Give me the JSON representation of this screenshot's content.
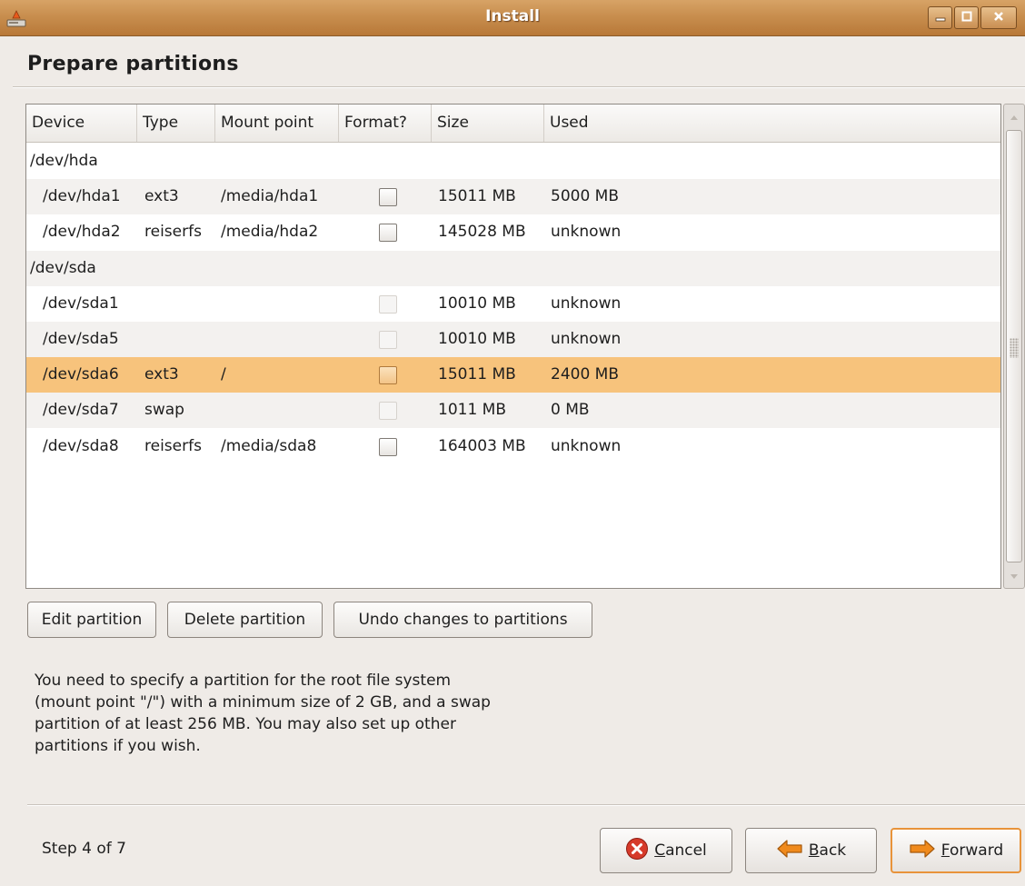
{
  "window": {
    "title": "Install"
  },
  "page": {
    "title": "Prepare partitions"
  },
  "table": {
    "columns": [
      "Device",
      "Type",
      "Mount point",
      "Format?",
      "Size",
      "Used"
    ],
    "rows": [
      {
        "device": "/dev/hda",
        "type": "",
        "mount": "",
        "format": "none",
        "size": "",
        "used": "",
        "is_disk": true
      },
      {
        "device": "/dev/hda1",
        "type": "ext3",
        "mount": "/media/hda1",
        "format": "unchecked",
        "size": "15011 MB",
        "used": "5000 MB",
        "is_disk": false
      },
      {
        "device": "/dev/hda2",
        "type": "reiserfs",
        "mount": "/media/hda2",
        "format": "unchecked",
        "size": "145028 MB",
        "used": "unknown",
        "is_disk": false
      },
      {
        "device": "/dev/sda",
        "type": "",
        "mount": "",
        "format": "none",
        "size": "",
        "used": "",
        "is_disk": true
      },
      {
        "device": "/dev/sda1",
        "type": "",
        "mount": "",
        "format": "disabled",
        "size": "10010 MB",
        "used": "unknown",
        "is_disk": false
      },
      {
        "device": "/dev/sda5",
        "type": "",
        "mount": "",
        "format": "disabled",
        "size": "10010 MB",
        "used": "unknown",
        "is_disk": false
      },
      {
        "device": "/dev/sda6",
        "type": "ext3",
        "mount": "/",
        "format": "unchecked",
        "size": "15011 MB",
        "used": "2400 MB",
        "is_disk": false,
        "selected": true
      },
      {
        "device": "/dev/sda7",
        "type": "swap",
        "mount": "",
        "format": "disabled",
        "size": "1011 MB",
        "used": "0 MB",
        "is_disk": false
      },
      {
        "device": "/dev/sda8",
        "type": "reiserfs",
        "mount": "/media/sda8",
        "format": "unchecked",
        "size": "164003 MB",
        "used": "unknown",
        "is_disk": false
      }
    ]
  },
  "buttons": {
    "edit": "Edit partition",
    "delete": "Delete partition",
    "undo": "Undo changes to partitions"
  },
  "info": "You need to specify a partition for the root file system (mount point \"/\") with a minimum size of 2 GB, and a swap partition of at least 256 MB. You may also set up other partitions if you wish.",
  "footer": {
    "step": "Step 4 of 7",
    "cancel_mnemonic": "C",
    "cancel_rest": "ancel",
    "back_mnemonic": "B",
    "back_rest": "ack",
    "forward_mnemonic": "F",
    "forward_rest": "orward"
  },
  "colors": {
    "titlebar": "#c88e4e",
    "selected_row": "#f7c37c",
    "forward_border": "#e8933a",
    "cancel_icon": "#d63a2a",
    "arrow_icon": "#f08a1c"
  },
  "icons": {
    "app": "installer-icon",
    "minimize": "minimize-icon",
    "maximize": "maximize-icon",
    "close": "close-icon",
    "cancel": "cancel-icon",
    "back": "back-arrow-icon",
    "forward": "forward-arrow-icon"
  }
}
